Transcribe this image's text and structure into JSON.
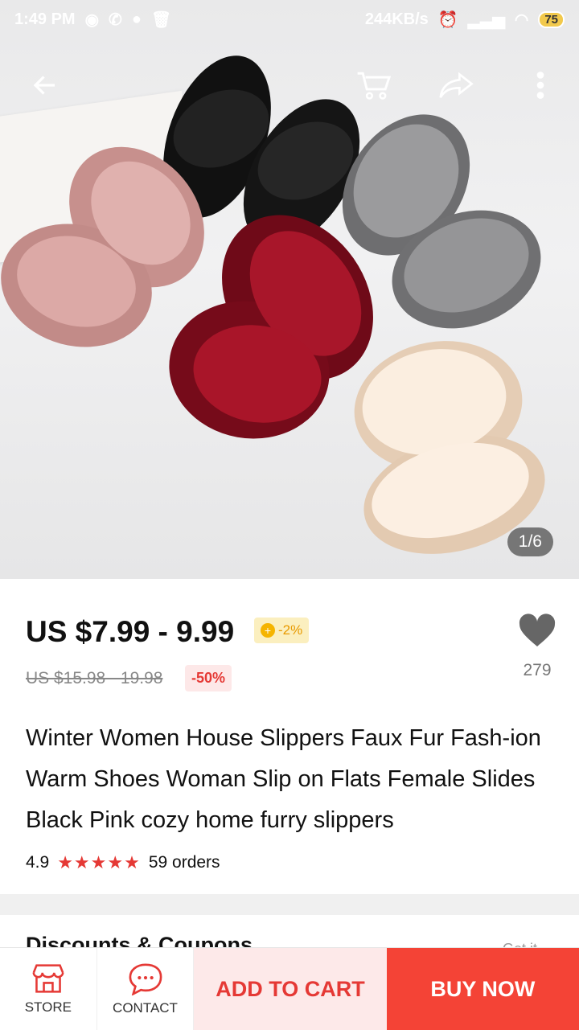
{
  "status_bar": {
    "time": "1:49 PM",
    "network_speed": "244KB/s",
    "battery": "75",
    "icons": [
      "messenger-icon",
      "whatsapp-icon",
      "chat-icon",
      "trash-icon",
      "alarm-icon",
      "signal-icon",
      "wifi-icon",
      "battery-icon"
    ]
  },
  "nav": {
    "back_icon": "back-arrow-icon",
    "cart_icon": "cart-icon",
    "share_icon": "share-icon",
    "more_icon": "more-vertical-icon"
  },
  "gallery": {
    "counter": "1/6",
    "colors": [
      "#1a1a1a",
      "#d9a3a0",
      "#8e8e90",
      "#9e1224",
      "#f3e3d3"
    ]
  },
  "product": {
    "price": "US $7.99 - 9.99",
    "coin_discount": "-2%",
    "original_price": "US $15.98 - 19.98",
    "discount_badge": "-50%",
    "wishlist_count": "279",
    "title": "Winter Women House Slippers Faux Fur Fash-ion Warm Shoes Woman Slip on Flats Female Slides Black Pink cozy home  furry slippers",
    "rating": "4.9",
    "stars": "★★★★★",
    "orders": "59 orders"
  },
  "next_section": {
    "title": "Discounts & Coupons",
    "right": "Get it"
  },
  "bottom_bar": {
    "store_label": "STORE",
    "contact_label": "CONTACT",
    "add_to_cart_label": "ADD TO CART",
    "buy_now_label": "BUY NOW"
  },
  "colors": {
    "accent_red": "#f44336",
    "light_red": "#fde9e9",
    "coin_yellow": "#f5b400"
  }
}
